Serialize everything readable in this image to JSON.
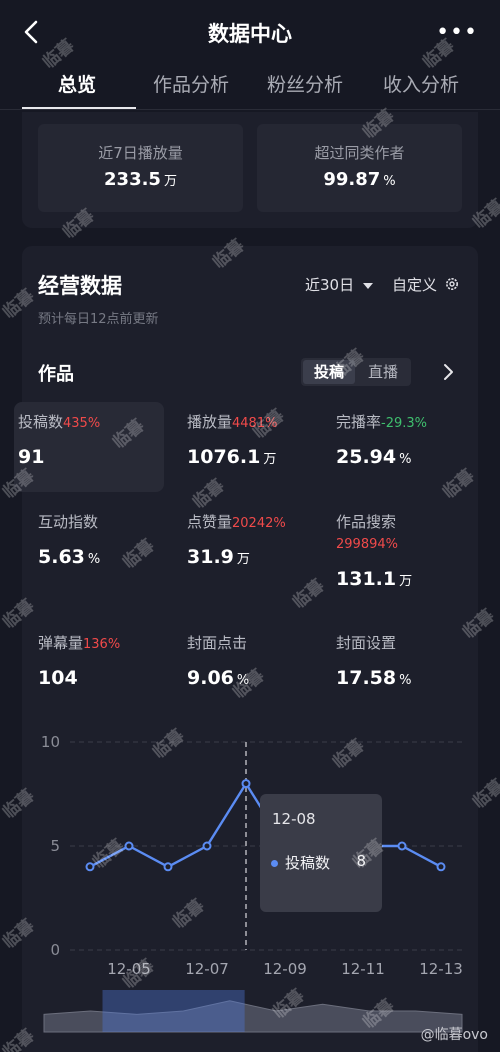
{
  "header": {
    "title": "数据中心",
    "more": "•••"
  },
  "tabs": [
    {
      "label": "总览",
      "active": true
    },
    {
      "label": "作品分析"
    },
    {
      "label": "粉丝分析"
    },
    {
      "label": "收入分析"
    }
  ],
  "summary": [
    {
      "label": "近7日播放量",
      "value": "233.5",
      "unit": "万"
    },
    {
      "label": "超过同类作者",
      "value": "99.87",
      "unit": "%"
    }
  ],
  "ops": {
    "title": "经营数据",
    "subtitle": "预计每日12点前更新",
    "range": "近30日",
    "custom": "自定义"
  },
  "works": {
    "title": "作品",
    "segments": [
      {
        "label": "投稿",
        "active": true
      },
      {
        "label": "直播"
      }
    ],
    "metrics": [
      {
        "label": "投稿数",
        "change": "435%",
        "dir": "up",
        "value": "91",
        "unit": "",
        "highlight": true
      },
      {
        "label": "播放量",
        "change": "4481%",
        "dir": "up",
        "value": "1076.1",
        "unit": "万"
      },
      {
        "label": "完播率",
        "change": "-29.3%",
        "dir": "down",
        "value": "25.94",
        "unit": "%"
      },
      {
        "label": "互动指数",
        "change": "",
        "dir": "",
        "value": "5.63",
        "unit": "%"
      },
      {
        "label": "点赞量",
        "change": "20242%",
        "dir": "up",
        "value": "31.9",
        "unit": "万"
      },
      {
        "label": "作品搜索",
        "change": "299894%",
        "dir": "up",
        "value": "131.1",
        "unit": "万"
      },
      {
        "label": "弹幕量",
        "change": "136%",
        "dir": "up",
        "value": "104",
        "unit": ""
      },
      {
        "label": "封面点击",
        "change": "",
        "dir": "",
        "value": "9.06",
        "unit": "%"
      },
      {
        "label": "封面设置",
        "change": "",
        "dir": "",
        "value": "17.58",
        "unit": "%"
      }
    ]
  },
  "chart_data": {
    "type": "line",
    "x": [
      "12-04",
      "12-05",
      "12-06",
      "12-07",
      "12-08",
      "12-09",
      "12-10",
      "12-11",
      "12-12",
      "12-13"
    ],
    "tick_labels": [
      "12-05",
      "12-07",
      "12-09",
      "12-11",
      "12-13"
    ],
    "series": [
      {
        "name": "投稿数",
        "values": [
          4,
          5,
          4,
          5,
          8,
          5,
          7,
          5,
          5,
          4
        ]
      }
    ],
    "ylim": [
      0,
      10
    ],
    "yticks": [
      "0",
      "5",
      "10"
    ],
    "grid": true,
    "color": "#5b8cf3",
    "tooltip": {
      "date": "12-08",
      "label": "投稿数",
      "value": "8"
    },
    "overview_window": [
      0.14,
      0.48
    ]
  },
  "watermark": "临暮",
  "credit": "@临暮ovo"
}
